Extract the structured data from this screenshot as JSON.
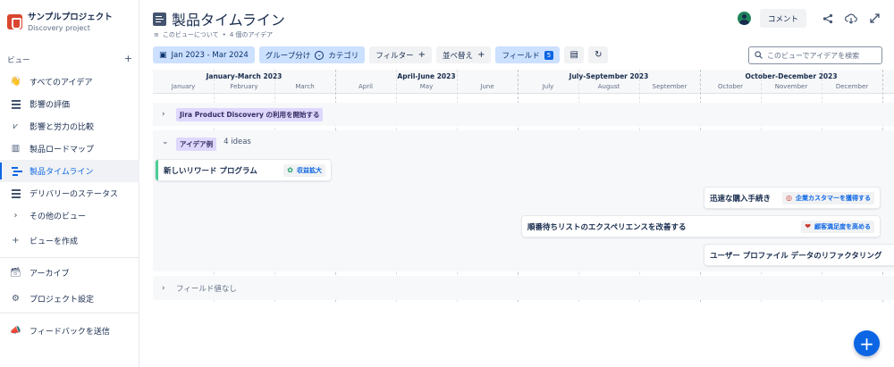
{
  "project": {
    "name": "サンプルプロジェクト",
    "subtitle": "Discovery project"
  },
  "sidebar": {
    "section_label": "ビュー",
    "add_label": "+",
    "items": [
      {
        "label": "すべてのアイデア",
        "icon": "wave-icon"
      },
      {
        "label": "影響の評価",
        "icon": "list-icon"
      },
      {
        "label": "影響と労力の比較",
        "icon": "scatter-chart-icon"
      },
      {
        "label": "製品ロードマップ",
        "icon": "board-icon"
      },
      {
        "label": "製品タイムライン",
        "icon": "timeline-icon",
        "active": true
      },
      {
        "label": "デリバリーのステータス",
        "icon": "list-icon"
      },
      {
        "label": "その他のビュー",
        "icon": "chevron-right-icon"
      },
      {
        "label": "ビューを作成",
        "icon": "plus-icon"
      }
    ],
    "archive": "アーカイブ",
    "settings": "プロジェクト設定",
    "feedback": "フィードバックを送信"
  },
  "header": {
    "title": "製品タイムライン",
    "about": "このビューについて",
    "separator": "•",
    "idea_count": "4 個のアイデア",
    "comment": "コメント"
  },
  "toolbar": {
    "date_range": "Jan 2023 - Mar 2024",
    "group_by": "グループ分け",
    "group_value": "カテゴリ",
    "filter": "フィルター",
    "sort": "並べ替え",
    "fields": "フィールド",
    "fields_count": "5",
    "plus": "+",
    "search_placeholder": "このビューでアイデアを検索"
  },
  "timeline": {
    "quarters": [
      "January-March 2023",
      "April-June 2023",
      "July-September 2023",
      "October-December 2023"
    ],
    "months": [
      "January",
      "February",
      "March",
      "April",
      "May",
      "June",
      "July",
      "August",
      "September",
      "October",
      "November",
      "December"
    ],
    "groups": [
      {
        "label": "Jira Product Discovery の利用を開始する",
        "collapsed": true
      },
      {
        "label": "アイデア例",
        "count": "4 ideas",
        "collapsed": false
      },
      {
        "label": "フィールド値なし",
        "collapsed": true
      }
    ],
    "ideas": [
      {
        "title": "新しいリワード プログラム",
        "tag": "収益拡大",
        "tag_icon": "sprout-icon"
      },
      {
        "title": "迅速な購入手続き",
        "tag": "企業カスタマーを獲得する",
        "tag_icon": "target-icon"
      },
      {
        "title": "順番待ちリストのエクスペリエンスを改善する",
        "tag": "顧客満足度を高める",
        "tag_icon": "heart-icon"
      },
      {
        "title": "ユーザー プロファイル データのリファクタリング",
        "tag": "",
        "tag_icon": ""
      }
    ]
  },
  "colors": {
    "accent": "#0c66e4",
    "group_tag": "#dfd8fd",
    "first_bar_edge": "#4bce97"
  }
}
